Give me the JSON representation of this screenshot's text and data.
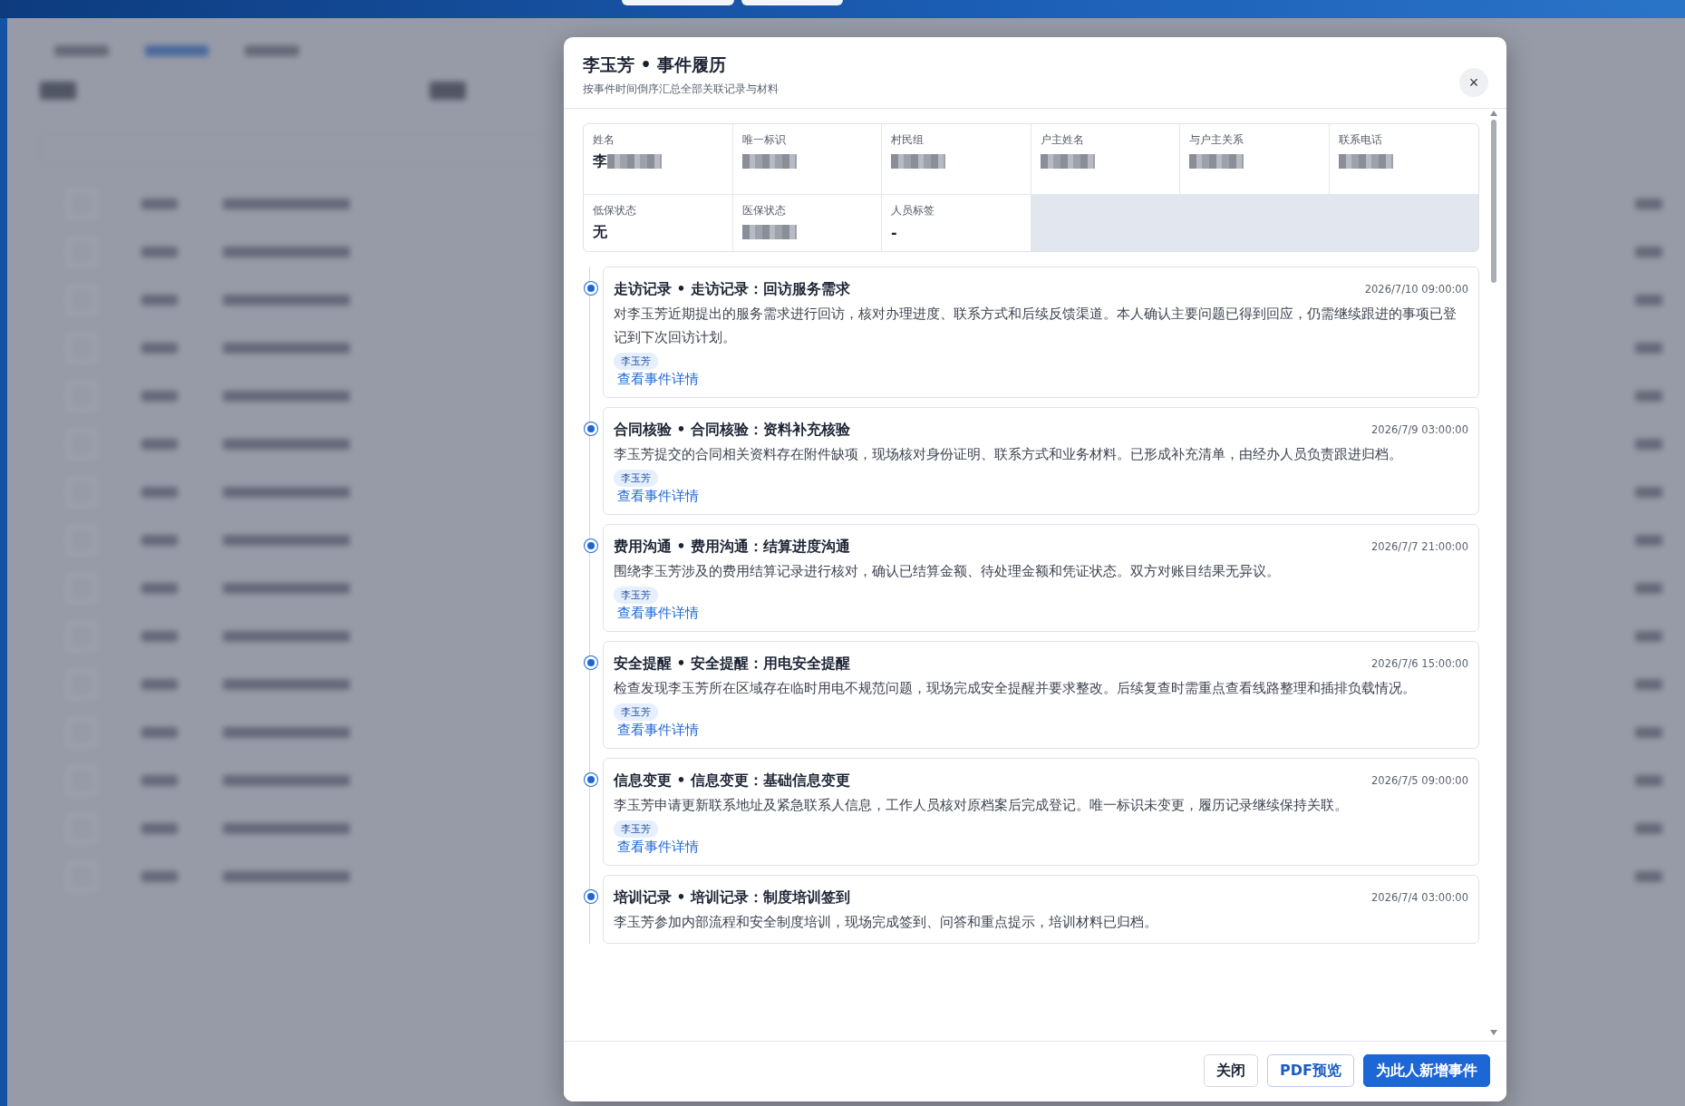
{
  "dialog": {
    "title": "李玉芳 • 事件履历",
    "subtitle": "按事件时间倒序汇总全部关联记录与材料",
    "close_icon": "×"
  },
  "profile_fields": [
    {
      "label": "姓名",
      "value": "李",
      "redacted": true
    },
    {
      "label": "唯一标识",
      "redacted": true
    },
    {
      "label": "村民组",
      "redacted": true
    },
    {
      "label": "户主姓名",
      "redacted": true
    },
    {
      "label": "与户主关系",
      "redacted": true
    },
    {
      "label": "联系电话",
      "redacted": true
    },
    {
      "label": "低保状态",
      "value": "无",
      "redacted": false
    },
    {
      "label": "医保状态",
      "redacted": true
    },
    {
      "label": "人员标签",
      "value": "-",
      "redacted": false
    }
  ],
  "events": [
    {
      "title": "走访记录 • 走访记录：回访服务需求",
      "time": "2026/7/10 09:00:00",
      "description": "对李玉芳近期提出的服务需求进行回访，核对办理进度、联系方式和后续反馈渠道。本人确认主要问题已得到回应，仍需继续跟进的事项已登记到下次回访计划。",
      "tag": "李玉芳",
      "link": "查看事件详情"
    },
    {
      "title": "合同核验 • 合同核验：资料补充核验",
      "time": "2026/7/9 03:00:00",
      "description": "李玉芳提交的合同相关资料存在附件缺项，现场核对身份证明、联系方式和业务材料。已形成补充清单，由经办人员负责跟进归档。",
      "tag": "李玉芳",
      "link": "查看事件详情"
    },
    {
      "title": "费用沟通 • 费用沟通：结算进度沟通",
      "time": "2026/7/7 21:00:00",
      "description": "围绕李玉芳涉及的费用结算记录进行核对，确认已结算金额、待处理金额和凭证状态。双方对账目结果无异议。",
      "tag": "李玉芳",
      "link": "查看事件详情"
    },
    {
      "title": "安全提醒 • 安全提醒：用电安全提醒",
      "time": "2026/7/6 15:00:00",
      "description": "检查发现李玉芳所在区域存在临时用电不规范问题，现场完成安全提醒并要求整改。后续复查时需重点查看线路整理和插排负载情况。",
      "tag": "李玉芳",
      "link": "查看事件详情"
    },
    {
      "title": "信息变更 • 信息变更：基础信息变更",
      "time": "2026/7/5 09:00:00",
      "description": "李玉芳申请更新联系地址及紧急联系人信息，工作人员核对原档案后完成登记。唯一标识未变更，履历记录继续保持关联。",
      "tag": "李玉芳",
      "link": "查看事件详情"
    },
    {
      "title": "培训记录 • 培训记录：制度培训签到",
      "time": "2026/7/4 03:00:00",
      "description": "李玉芳参加内部流程和安全制度培训，现场完成签到、问答和重点提示，培训材料已归档。"
    }
  ],
  "buttons": [
    {
      "label": "关闭",
      "kind": "default"
    },
    {
      "label": "PDF预览",
      "kind": "outline"
    },
    {
      "label": "为此人新增事件",
      "kind": "primary"
    }
  ]
}
